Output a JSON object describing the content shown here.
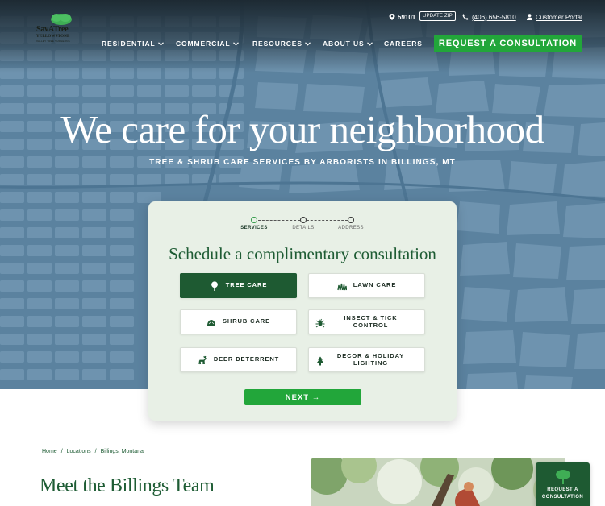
{
  "brand": {
    "name": "SavATree",
    "subtitle": "YELLOWSTONE",
    "tagline": "VALLEY TREE SURGEONS",
    "accent": "#22a63a",
    "dark_green": "#1e5a32"
  },
  "utility": {
    "zip": "59101",
    "update_zip": "UPDATE ZIP",
    "phone": "(406) 656-5810",
    "portal": "Customer Portal"
  },
  "nav": {
    "items": [
      {
        "label": "RESIDENTIAL",
        "dropdown": true
      },
      {
        "label": "COMMERCIAL",
        "dropdown": true
      },
      {
        "label": "RESOURCES",
        "dropdown": true
      },
      {
        "label": "ABOUT US",
        "dropdown": true
      },
      {
        "label": "CAREERS",
        "dropdown": false
      }
    ],
    "cta": "REQUEST A CONSULTATION"
  },
  "hero": {
    "headline": "We care for your neighborhood",
    "subheadline": "TREE & SHRUB CARE SERVICES BY ARBORISTS IN BILLINGS, MT"
  },
  "form": {
    "steps": [
      {
        "label": "SERVICES",
        "active": true
      },
      {
        "label": "DETAILS",
        "active": false
      },
      {
        "label": "ADDRESS",
        "active": false
      }
    ],
    "title": "Schedule a complimentary consultation",
    "options": [
      {
        "label": "TREE CARE",
        "icon": "tree-icon",
        "selected": true
      },
      {
        "label": "LAWN CARE",
        "icon": "grass-icon",
        "selected": false
      },
      {
        "label": "SHRUB CARE",
        "icon": "shrub-icon",
        "selected": false
      },
      {
        "label": "INSECT & TICK CONTROL",
        "icon": "bug-icon",
        "selected": false
      },
      {
        "label": "DEER DETERRENT",
        "icon": "deer-icon",
        "selected": false
      },
      {
        "label": "DECOR & HOLIDAY LIGHTING",
        "icon": "pine-tree-icon",
        "selected": false
      }
    ],
    "next": "NEXT →"
  },
  "breadcrumb": [
    "Home",
    "/",
    "Locations",
    "/",
    "Billings, Montana"
  ],
  "section_title": "Meet the Billings Team",
  "floating_cta": "REQUEST A CONSULTATION"
}
